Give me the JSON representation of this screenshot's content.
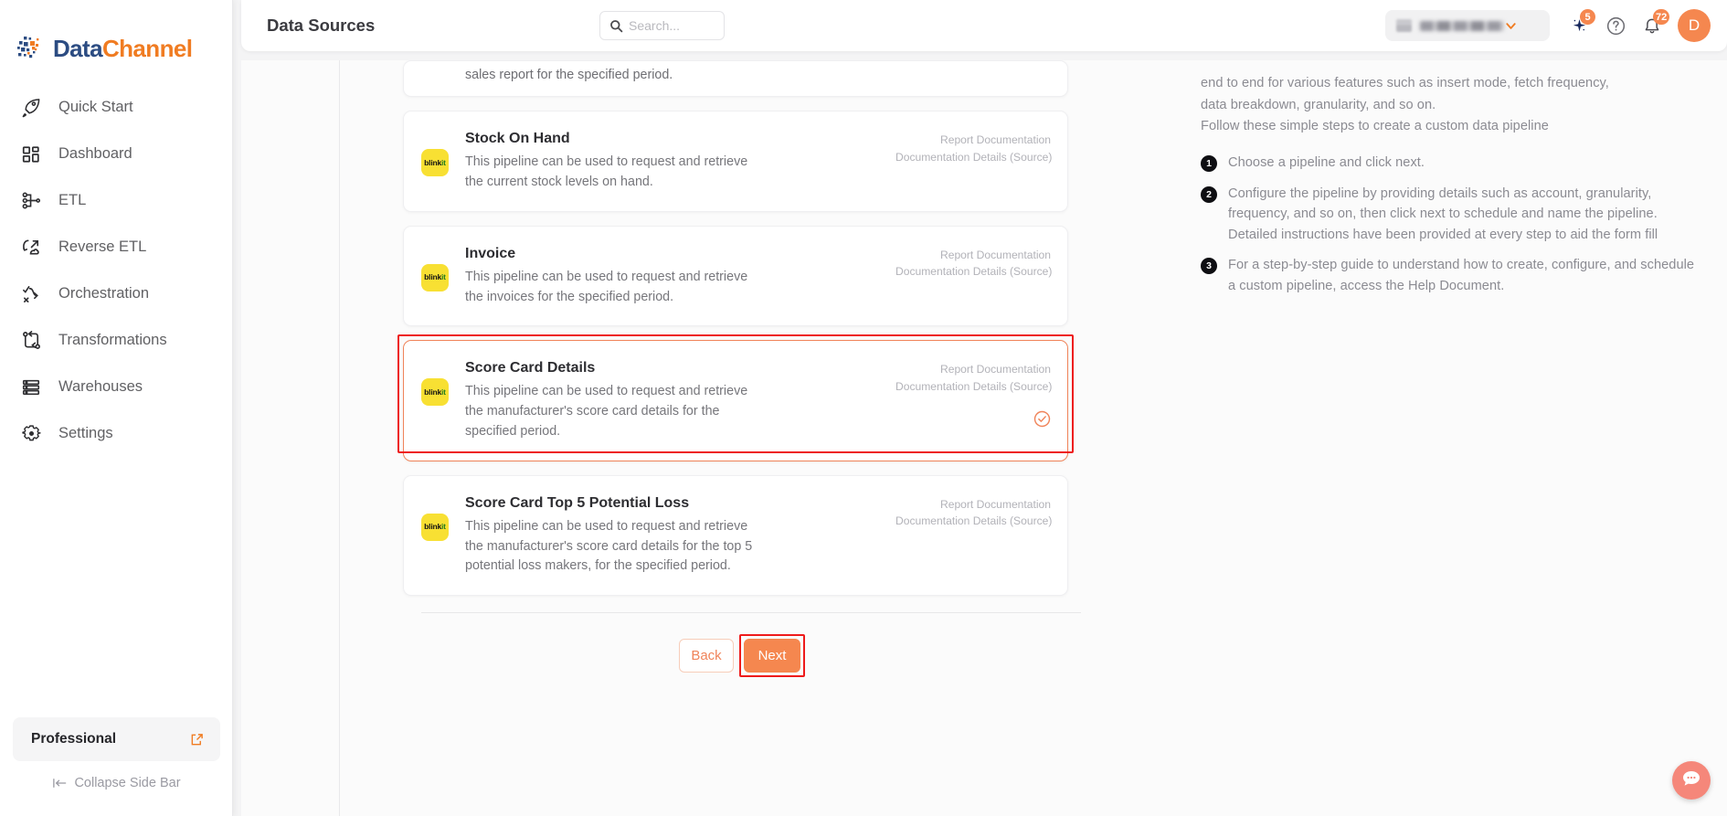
{
  "brand": {
    "part1": "Data",
    "part2": "Channel",
    "logo_icon": "datachannel-logo-icon"
  },
  "sidebar": {
    "items": [
      {
        "label": "Quick Start",
        "icon": "rocket-icon"
      },
      {
        "label": "Dashboard",
        "icon": "grid-squares-icon"
      },
      {
        "label": "ETL",
        "icon": "etl-branch-icon"
      },
      {
        "label": "Reverse ETL",
        "icon": "reverse-etl-icon"
      },
      {
        "label": "Orchestration",
        "icon": "orchestration-icon"
      },
      {
        "label": "Transformations",
        "icon": "transformations-icon"
      },
      {
        "label": "Warehouses",
        "icon": "warehouse-stack-icon"
      },
      {
        "label": "Settings",
        "icon": "gear-icon"
      }
    ],
    "plan": {
      "label": "Professional",
      "icon": "external-link-icon"
    },
    "collapse": {
      "label": "Collapse Side Bar",
      "icon": "collapse-arrow-icon"
    }
  },
  "header": {
    "title": "Data Sources",
    "search": {
      "value": "",
      "placeholder": "Search...",
      "icon": "search-icon"
    },
    "workspace": {
      "value": "",
      "caret_icon": "chevron-down-icon",
      "db_icon": "database-icon"
    },
    "ai_spark": {
      "icon": "sparkle-icon",
      "badge": "5"
    },
    "help": {
      "icon": "help-circle-icon"
    },
    "notifications": {
      "icon": "bell-icon",
      "badge": "72"
    },
    "avatar": {
      "initial": "D"
    }
  },
  "main": {
    "partial_card_text": "sales report for the specified period.",
    "link_labels": [
      "Report Documentation",
      "Documentation Details (Source)"
    ],
    "logo": {
      "part1": "blink",
      "part2": "it",
      "color": "#f8e033"
    },
    "cards": [
      {
        "title": "Stock On Hand",
        "desc": "This pipeline can be used to request and retrieve the current stock levels on hand.",
        "selected": false
      },
      {
        "title": "Invoice",
        "desc": "This pipeline can be used to request and retrieve the invoices for the specified period.",
        "selected": false
      },
      {
        "title": "Score Card Details",
        "desc": "This pipeline can be used to request and retrieve the manufacturer's score card details for the specified period.",
        "selected": true,
        "check_icon": "check-circle-icon"
      },
      {
        "title": "Score Card Top 5 Potential Loss",
        "desc": "This pipeline can be used to request and retrieve the manufacturer's score card details for the top 5 potential loss makers, for the specified period.",
        "selected": false
      }
    ],
    "footer": {
      "back_label": "Back",
      "next_label": "Next"
    }
  },
  "right_panel": {
    "intro_line1": "end to end for various features such as insert mode, fetch frequency,",
    "intro_line2": "data breakdown, granularity, and so on.",
    "intro_line3": "Follow these simple steps to create a custom data pipeline",
    "steps": [
      {
        "num": "1",
        "text": "Choose a pipeline and click next."
      },
      {
        "num": "2",
        "text": "Configure the pipeline by providing details such as account, granularity, frequency, and so on, then click next to schedule and name the pipeline. Detailed instructions have been provided at every step to aid the form fill"
      },
      {
        "num": "3",
        "text": "For a step-by-step guide to understand how to create, configure, and schedule a custom pipeline, access the Help Document."
      }
    ]
  },
  "chat": {
    "icon": "chat-bubble-icon"
  },
  "colors": {
    "accent_orange": "#f5874f",
    "brand_blue": "#2c4c82",
    "brand_orange": "#f07c22",
    "annotation_red": "#ee1b1b",
    "blinkit_yellow": "#f8e033"
  }
}
